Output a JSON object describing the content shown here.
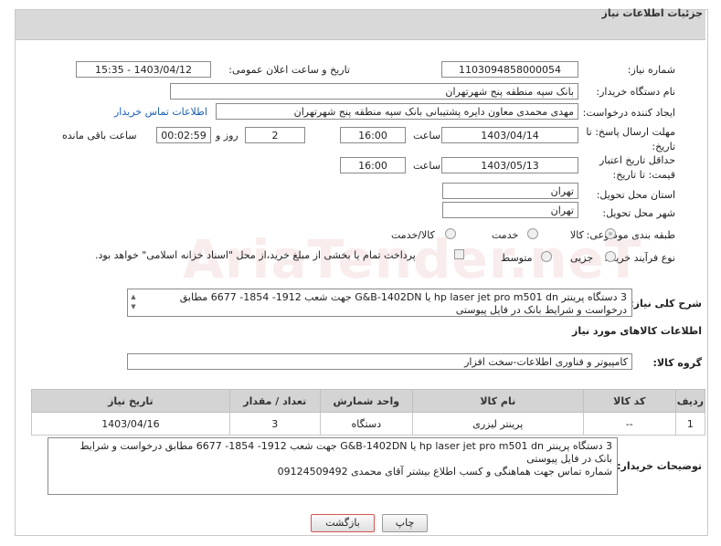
{
  "header": {
    "title": "جزئیات اطلاعات نیاز"
  },
  "labels": {
    "need_number": "شماره نیاز:",
    "announce_datetime": "تاریخ و ساعت اعلان عمومی:",
    "buyer_org": "نام دستگاه خریدار:",
    "requester": "ایجاد کننده درخواست:",
    "reply_deadline": "مهلت ارسال پاسخ: تا تاریخ:",
    "time": "ساعت",
    "day_and": "روز و",
    "remaining": "ساعت باقی مانده",
    "price_validity": "حداقل تاریخ اعتبار قیمت: تا تاریخ:",
    "province": "استان محل تحویل:",
    "city": "شهر محل تحویل:",
    "category": "طبقه بندی موضوعی:",
    "process_type": "نوع فرآیند خرید :",
    "need_summary": "شرح کلی نیاز:",
    "goods_info": "اطلاعات کالاهای مورد نیاز",
    "goods_group": "گروه کالا:",
    "buyer_notes": "توضیحات خریدار:"
  },
  "fields": {
    "need_number": "1103094858000054",
    "announce_datetime": "1403/04/12 - 15:35",
    "buyer_org": "بانک سپه منطقه پنج شهرتهران",
    "requester": "مهدی محمدی معاون دایره پشتیبانی بانک سپه منطقه پنج شهرتهران",
    "contact_link": "اطلاعات تماس خریدار",
    "reply_date": "1403/04/14",
    "reply_time": "16:00",
    "days": "2",
    "remaining_time": "00:02:59",
    "validity_date": "1403/05/13",
    "validity_time": "16:00",
    "province": "تهران",
    "city": "تهران",
    "goods_group": "کامپیوتر و فناوری اطلاعات-سخت افزار"
  },
  "category_options": [
    "کالا",
    "خدمت",
    "کالا/خدمت"
  ],
  "process_options": [
    "جزیی",
    "متوسط"
  ],
  "payment_note": "پرداخت تمام یا بخشی از مبلغ خرید،از محل \"اسناد خزانه اسلامی\" خواهد بود.",
  "need_summary_lines": [
    "3 دستگاه پرینتر hp laser jet pro m501 dn یا G&B-1402DN جهت شعب 1912- 1854- 6677 مطابق",
    "درخواست و شرایط بانک در فایل پیوستی"
  ],
  "table": {
    "headers": [
      "ردیف",
      "کد کالا",
      "نام کالا",
      "واحد شمارش",
      "تعداد / مقدار",
      "تاریخ نیاز"
    ],
    "rows": [
      [
        "1",
        "--",
        "پرینتر لیزری",
        "دستگاه",
        "3",
        "1403/04/16"
      ]
    ]
  },
  "buyer_notes_lines": [
    "3 دستگاه پرینتر hp laser jet pro m501 dn یا G&B-1402DN جهت شعب 1912- 1854- 6677 مطابق درخواست و شرایط",
    "بانک در فایل پیوستی",
    "شماره تماس جهت هماهنگی و کسب اطلاع بیشتر آقای محمدی 09124509492"
  ],
  "buttons": {
    "print": "چاپ",
    "back": "بازگشت"
  },
  "watermark": "AriaTender.neT",
  "colors": {
    "header_bg": "#d9d9d9",
    "link": "#1a5fb4",
    "back_button_border": "#d9534f"
  }
}
